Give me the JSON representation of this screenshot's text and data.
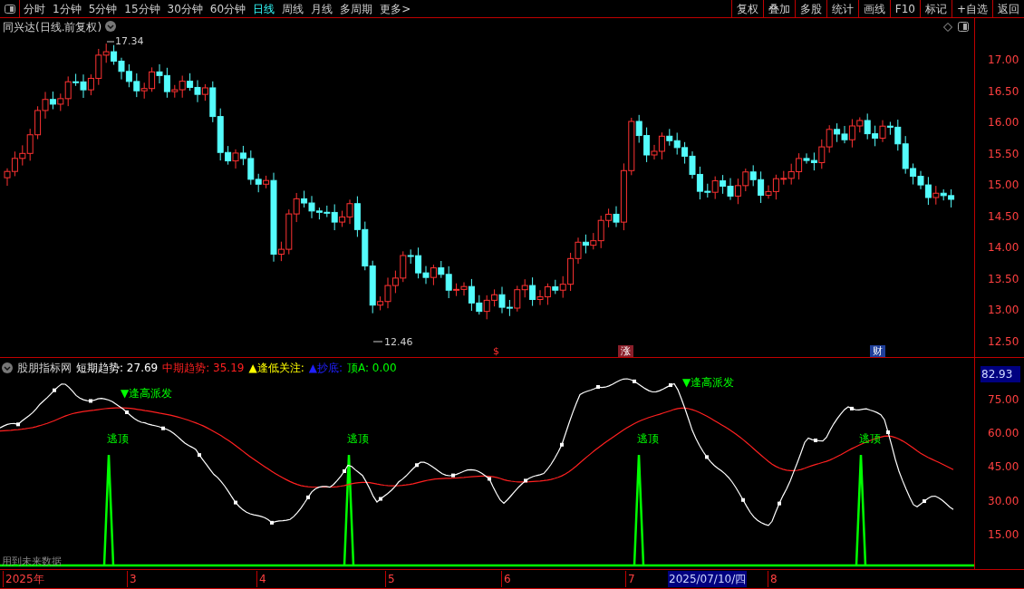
{
  "toolbar": {
    "periods": [
      {
        "label": "分时",
        "selected": false
      },
      {
        "label": "1分钟",
        "selected": false
      },
      {
        "label": "5分钟",
        "selected": false
      },
      {
        "label": "15分钟",
        "selected": false
      },
      {
        "label": "30分钟",
        "selected": false
      },
      {
        "label": "60分钟",
        "selected": false
      },
      {
        "label": "日线",
        "selected": true
      },
      {
        "label": "周线",
        "selected": false
      },
      {
        "label": "月线",
        "selected": false
      },
      {
        "label": "多周期",
        "selected": false
      },
      {
        "label": "更多>",
        "selected": false
      }
    ],
    "actions": [
      "复权",
      "叠加",
      "多股",
      "统计",
      "画线",
      "F10",
      "标记",
      "+自选",
      "返回"
    ]
  },
  "main_chart": {
    "title": "同兴达(日线.前复权)",
    "price_axis": [
      "17.00",
      "16.50",
      "16.00",
      "15.50",
      "15.00",
      "14.50",
      "14.00",
      "13.50",
      "13.00",
      "12.50"
    ],
    "high_label": "17.34",
    "low_label": "12.46",
    "events": [
      {
        "label": "$",
        "color": "#000000"
      },
      {
        "label": "涨",
        "color": "#8a1f2a"
      },
      {
        "label": "财",
        "color": "#1f3f9a"
      }
    ]
  },
  "indicator": {
    "name": "股朋指标网",
    "legend": [
      {
        "label": "短期趋势: 27.69",
        "color": "#ffffff"
      },
      {
        "label": "中期趋势: 35.19",
        "color": "#ff2020"
      },
      {
        "label": "▲逢低关注:",
        "color": "#ffff00"
      },
      {
        "label": "▲抄底:",
        "color": "#2020ff"
      },
      {
        "label": "顶A: 0.00",
        "color": "#00ff00"
      }
    ],
    "current_value": "82.93",
    "axis": [
      "75.00",
      "60.00",
      "45.00",
      "30.00",
      "15.00"
    ],
    "signals": [
      {
        "kind": "escape",
        "label": "逃顶"
      },
      {
        "kind": "escape",
        "label": "逃顶"
      },
      {
        "kind": "escape",
        "label": "逃顶"
      },
      {
        "kind": "escape",
        "label": "逃顶"
      },
      {
        "kind": "sell",
        "label": "▼逢高派发"
      },
      {
        "kind": "sell",
        "label": "▼逢高派发"
      }
    ],
    "note": "用到未来数据"
  },
  "date_axis": {
    "labels": [
      "2025年",
      "3",
      "4",
      "5",
      "6",
      "7",
      "8"
    ],
    "cursor_date": "2025/07/10/四"
  }
}
